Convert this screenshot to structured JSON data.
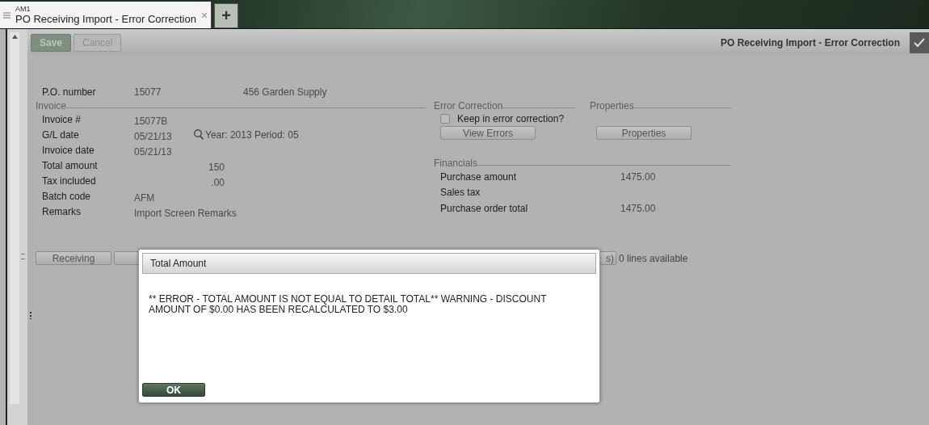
{
  "tabs": [
    {
      "subtitle": "AM1",
      "label": "PO Receiving Import - Error Correction",
      "close": "×",
      "selected": true
    }
  ],
  "new_tab": "+",
  "toolbar": {
    "buttons": [
      {
        "label": "Save",
        "kind": "primary"
      },
      {
        "label": "Cancel",
        "kind": "secondary"
      }
    ],
    "title": "PO Receiving Import - Error Correction"
  },
  "po": {
    "label": "P.O. number",
    "number": "15077",
    "vendor": "456 Garden Supply"
  },
  "invoice": {
    "title": "Invoice",
    "fields": [
      {
        "label": "Invoice #",
        "value": "15077B",
        "kind": "text"
      },
      {
        "label": "G/L date",
        "value": "05/21/13",
        "kind": "text",
        "note": "Year: 2013 Period: 05"
      },
      {
        "label": "Invoice date",
        "value": "05/21/13",
        "kind": "text"
      },
      {
        "label": "Total amount",
        "value": "150",
        "kind": "amount"
      },
      {
        "label": "Tax included",
        "value": ".00",
        "kind": "amount"
      },
      {
        "label": "Batch code",
        "value": "AFM",
        "kind": "text"
      },
      {
        "label": "Remarks",
        "value": "Import Screen Remarks",
        "kind": "text"
      }
    ]
  },
  "error_correction": {
    "title": "Error Correction",
    "checkbox": {
      "label": "Keep in error correction?",
      "checked": false
    },
    "button": "View Errors"
  },
  "properties": {
    "title": "Properties",
    "button": "Properties"
  },
  "financials": {
    "title": "Financials",
    "rows": [
      {
        "label": "Purchase amount",
        "value": "1475.00"
      },
      {
        "label": "Sales tax",
        "value": ""
      },
      {
        "label": "Purchase order total",
        "value": "1475.00"
      }
    ]
  },
  "actions": {
    "receiving": "Receiving",
    "partial": "s)",
    "lines": "0 lines available"
  },
  "dialog": {
    "title": "Total Amount",
    "message": "** ERROR - TOTAL AMOUNT IS NOT EQUAL TO DETAIL TOTAL** WARNING - DISCOUNT AMOUNT OF $0.00 HAS BEEN RECALCULATED TO $3.00",
    "button": "OK"
  }
}
